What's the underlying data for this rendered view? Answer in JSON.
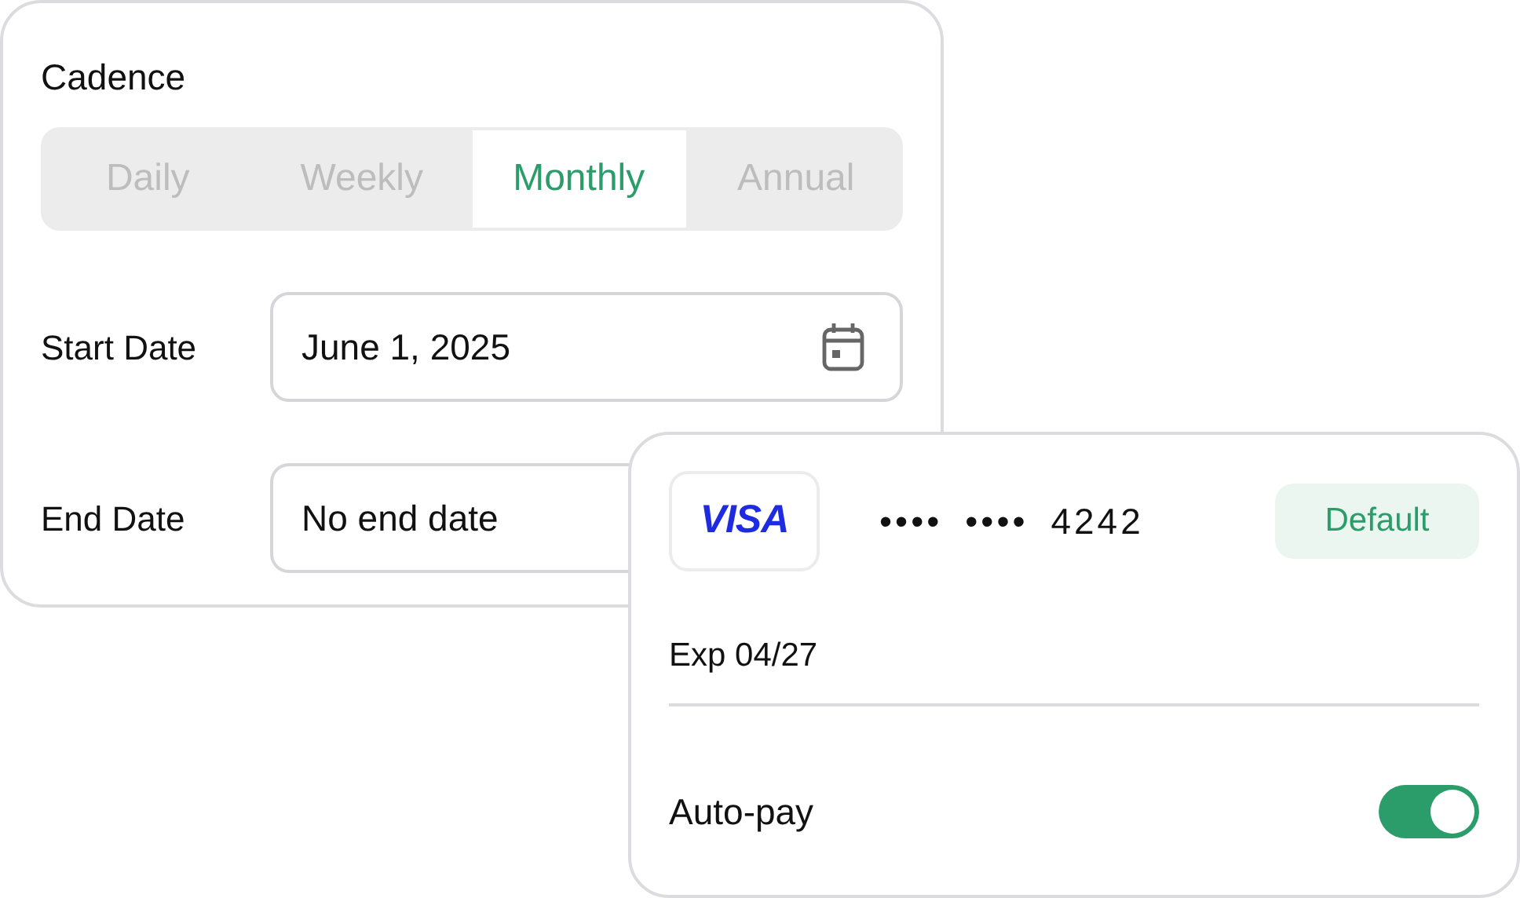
{
  "schedule": {
    "title": "Cadence",
    "cadence_options": [
      {
        "label": "Daily",
        "selected": false
      },
      {
        "label": "Weekly",
        "selected": false
      },
      {
        "label": "Monthly",
        "selected": true
      },
      {
        "label": "Annual",
        "selected": false
      }
    ],
    "fields": [
      {
        "label": "Start Date",
        "value": "June 1, 2025",
        "calendar": true
      },
      {
        "label": "End Date",
        "value": "No end date",
        "calendar": false
      }
    ]
  },
  "payment_card": {
    "brand": "VISA",
    "number": "•••• •••• 4242",
    "badge": "Default",
    "expiry": "Exp 04/27",
    "autopay": {
      "label": "Auto-pay",
      "on": true
    }
  }
}
